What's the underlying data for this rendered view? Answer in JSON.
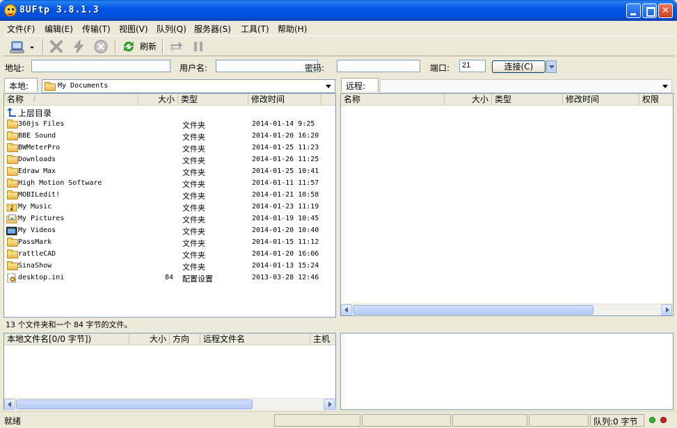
{
  "window": {
    "title": "8UFtp 3.8.1.3"
  },
  "menu": [
    "文件(F)",
    "编辑(E)",
    "传输(T)",
    "视图(V)",
    "队列(Q)",
    "服务器(S)",
    "工具(T)",
    "帮助(H)"
  ],
  "toolbar": {
    "refresh_label": "刷新"
  },
  "address": {
    "address_label": "地址:",
    "address_value": "",
    "user_label": "用户名:",
    "user_value": "",
    "password_label": "密码:",
    "password_value": "",
    "port_label": "端口:",
    "port_value": "21",
    "connect_label": "连接(C)"
  },
  "local": {
    "tab_label": "本地:",
    "path": "My Documents",
    "columns": [
      "名称",
      "大小",
      "类型",
      "修改时间"
    ],
    "sort_indicator": "/",
    "parent_label": "上层目录",
    "files": [
      {
        "name": "360js Files",
        "size": "",
        "type": "文件夹",
        "date": "2014-01-14 9:25",
        "icon": "folder-icon"
      },
      {
        "name": "BBE Sound",
        "size": "",
        "type": "文件夹",
        "date": "2014-01-20 16:20",
        "icon": "folder-icon"
      },
      {
        "name": "BWMeterPro",
        "size": "",
        "type": "文件夹",
        "date": "2014-01-25 11:23",
        "icon": "folder-icon"
      },
      {
        "name": "Downloads",
        "size": "",
        "type": "文件夹",
        "date": "2014-01-26 11:25",
        "icon": "folder-icon"
      },
      {
        "name": "Edraw Max",
        "size": "",
        "type": "文件夹",
        "date": "2014-01-25 10:41",
        "icon": "folder-icon"
      },
      {
        "name": "High Motion Software",
        "size": "",
        "type": "文件夹",
        "date": "2014-01-11 11:57",
        "icon": "folder-icon"
      },
      {
        "name": "MOBILedit!",
        "size": "",
        "type": "文件夹",
        "date": "2014-01-21 10:58",
        "icon": "folder-icon"
      },
      {
        "name": "My Music",
        "size": "",
        "type": "文件夹",
        "date": "2014-01-23 11:19",
        "icon": "music-folder-icon"
      },
      {
        "name": "My Pictures",
        "size": "",
        "type": "文件夹",
        "date": "2014-01-19 10:45",
        "icon": "pictures-folder-icon"
      },
      {
        "name": "My Videos",
        "size": "",
        "type": "文件夹",
        "date": "2014-01-20 10:40",
        "icon": "videos-folder-icon"
      },
      {
        "name": "PassMark",
        "size": "",
        "type": "文件夹",
        "date": "2014-01-15 11:12",
        "icon": "folder-icon"
      },
      {
        "name": "rattleCAD",
        "size": "",
        "type": "文件夹",
        "date": "2014-01-20 16:06",
        "icon": "folder-icon"
      },
      {
        "name": "SinaShow",
        "size": "",
        "type": "文件夹",
        "date": "2014-01-13 15:24",
        "icon": "folder-icon"
      },
      {
        "name": "desktop.ini",
        "size": "84",
        "type": "配置设置",
        "date": "2013-03-28 12:46",
        "icon": "config-file-icon"
      }
    ],
    "status": "13 个文件夹和一个 84 字节的文件。"
  },
  "remote": {
    "tab_label": "远程:",
    "path": "",
    "columns": [
      "名称",
      "大小",
      "类型",
      "修改时间",
      "权限"
    ]
  },
  "queue": {
    "columns": [
      "本地文件名[0/0 字节])",
      "大小",
      "方向",
      "远程文件名",
      "主机"
    ]
  },
  "statusbar": {
    "ready": "就绪",
    "queue_text": "队列:0 字节"
  },
  "colors": {
    "titlebar": "#0050d8",
    "face": "#ece9d8",
    "led_green": "#2fb52f",
    "led_red": "#d02020"
  }
}
